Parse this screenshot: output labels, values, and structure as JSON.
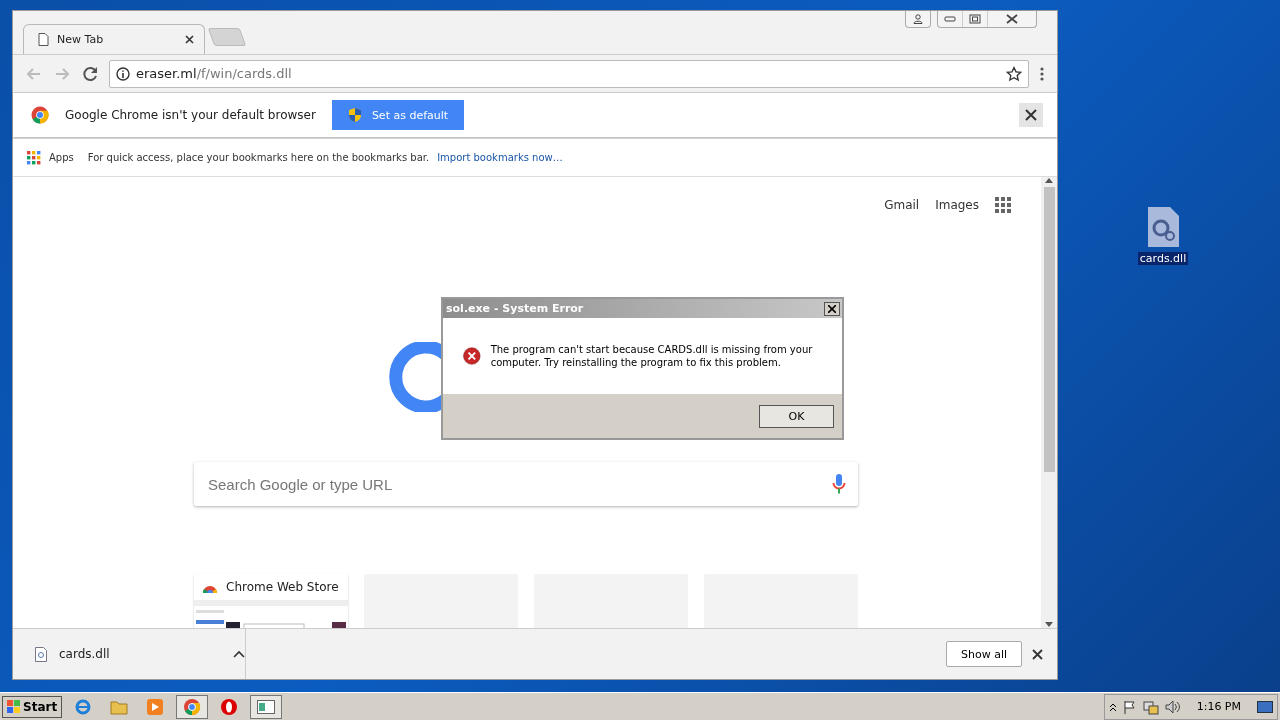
{
  "browser": {
    "tabs": [
      {
        "label": "New Tab",
        "selected": true
      }
    ],
    "address": {
      "domain": "eraser.ml",
      "path": "/f/win/cards.dll"
    },
    "infobar": {
      "message": "Google Chrome isn't your default browser",
      "button": "Set as default"
    },
    "bookmarks_bar": {
      "apps": "Apps",
      "hint": "For quick access, place your bookmarks here on the bookmarks bar.",
      "link": "Import bookmarks now…"
    },
    "page": {
      "links": [
        "Gmail",
        "Images"
      ],
      "search": {
        "placeholder": "Search Google or type URL"
      },
      "tiles": [
        {
          "kind": "site",
          "title": "Chrome Web Store"
        },
        {
          "kind": "blank"
        },
        {
          "kind": "blank"
        },
        {
          "kind": "blank"
        }
      ]
    },
    "download_bar": {
      "items": [
        {
          "name": "cards.dll"
        }
      ],
      "show_all": "Show all"
    }
  },
  "dialog": {
    "title": "sol.exe - System Error",
    "message": "The program can't start because CARDS.dll is missing from your computer. Try reinstalling the program to fix this problem.",
    "button": "OK"
  },
  "desktop_icons": [
    {
      "label": "cards.dll",
      "selected": true
    }
  ],
  "taskbar": {
    "start": "Start",
    "clock": "1:16 PM"
  }
}
